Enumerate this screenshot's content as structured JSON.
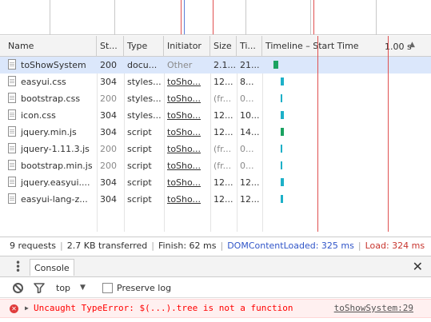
{
  "timeline_scale": "1.00 s",
  "columns": {
    "name": "Name",
    "status": "St...",
    "type": "Type",
    "initiator": "Initiator",
    "size": "Size",
    "time": "Ti...",
    "timeline": "Timeline – Start Time"
  },
  "rows": [
    {
      "name": "toShowSystem",
      "status": "200",
      "type": "docu...",
      "initiator": "Other",
      "size": "2.1...",
      "time": "21...",
      "bar_color": "#1aa260"
    },
    {
      "name": "easyui.css",
      "status": "304",
      "type": "styles...",
      "initiator": "toSho...",
      "size": "12...",
      "time": "8...",
      "bar_color": "#1db0c8"
    },
    {
      "name": "bootstrap.css",
      "status": "200",
      "type": "styles...",
      "initiator": "toSho...",
      "size": "(fr...",
      "time": "0...",
      "bar_color": "#1db0c8"
    },
    {
      "name": "icon.css",
      "status": "304",
      "type": "styles...",
      "initiator": "toSho...",
      "size": "12...",
      "time": "10...",
      "bar_color": "#1db0c8"
    },
    {
      "name": "jquery.min.js",
      "status": "304",
      "type": "script",
      "initiator": "toSho...",
      "size": "12...",
      "time": "14...",
      "bar_color": "#1aa260"
    },
    {
      "name": "jquery-1.11.3.js",
      "status": "200",
      "type": "script",
      "initiator": "toSho...",
      "size": "(fr...",
      "time": "0...",
      "bar_color": "#1db0c8"
    },
    {
      "name": "bootstrap.min.js",
      "status": "200",
      "type": "script",
      "initiator": "toSho...",
      "size": "(fr...",
      "time": "0...",
      "bar_color": "#1db0c8"
    },
    {
      "name": "jquery.easyui....",
      "status": "304",
      "type": "script",
      "initiator": "toSho...",
      "size": "12...",
      "time": "12...",
      "bar_color": "#1db0c8"
    },
    {
      "name": "easyui-lang-z...",
      "status": "304",
      "type": "script",
      "initiator": "toSho...",
      "size": "12...",
      "time": "12...",
      "bar_color": "#1db0c8"
    }
  ],
  "summary": {
    "requests": "9 requests",
    "transferred": "2.7 KB transferred",
    "finish": "Finish: 62 ms",
    "dom_content_loaded": "DOMContentLoaded: 325 ms",
    "load": "Load: 324 ms",
    "dcl_color": "#3055c8",
    "load_color": "#c8352e"
  },
  "drawer": {
    "tab_label": "Console",
    "close_glyph": "✕",
    "context": "top",
    "preserve_log_label": "Preserve log",
    "preserve_log_checked": false
  },
  "console": {
    "error_message": "Uncaught TypeError: $(...).tree is not a function",
    "error_source": "toShowSystem:29"
  }
}
